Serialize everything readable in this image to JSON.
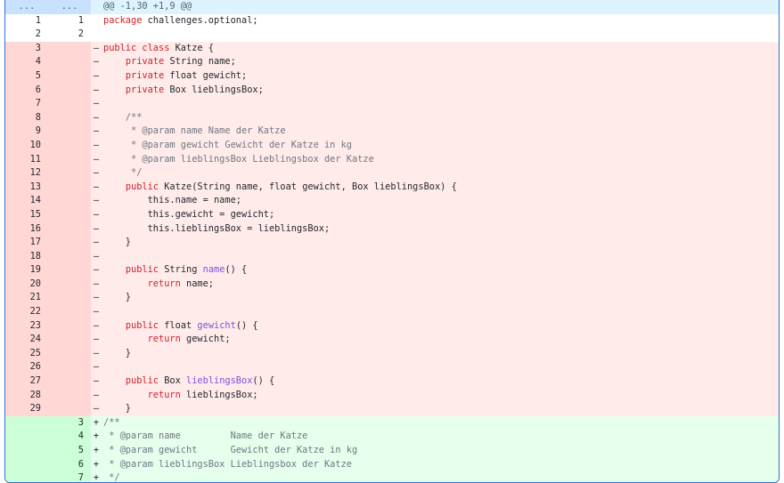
{
  "diff": {
    "hunk_header": "@@ -1,30 +1,9 @@",
    "expand_left": "...",
    "expand_right": "...",
    "lines": [
      {
        "type": "ctx",
        "old": "1",
        "new": "1",
        "sign": "",
        "tokens": [
          {
            "t": "kw",
            "v": "package"
          },
          {
            "t": "",
            "v": " challenges.optional;"
          }
        ]
      },
      {
        "type": "ctx",
        "old": "2",
        "new": "2",
        "sign": "",
        "tokens": []
      },
      {
        "type": "del",
        "old": "3",
        "new": "",
        "sign": "–",
        "tokens": [
          {
            "t": "kw",
            "v": "public class"
          },
          {
            "t": "",
            "v": " Katze {"
          }
        ]
      },
      {
        "type": "del",
        "old": "4",
        "new": "",
        "sign": "–",
        "tokens": [
          {
            "t": "",
            "v": "    "
          },
          {
            "t": "kw",
            "v": "private"
          },
          {
            "t": "",
            "v": " String name;"
          }
        ]
      },
      {
        "type": "del",
        "old": "5",
        "new": "",
        "sign": "–",
        "tokens": [
          {
            "t": "",
            "v": "    "
          },
          {
            "t": "kw",
            "v": "private"
          },
          {
            "t": "",
            "v": " float gewicht;"
          }
        ]
      },
      {
        "type": "del",
        "old": "6",
        "new": "",
        "sign": "–",
        "tokens": [
          {
            "t": "",
            "v": "    "
          },
          {
            "t": "kw",
            "v": "private"
          },
          {
            "t": "",
            "v": " Box lieblingsBox;"
          }
        ]
      },
      {
        "type": "del",
        "old": "7",
        "new": "",
        "sign": "–",
        "tokens": []
      },
      {
        "type": "del",
        "old": "8",
        "new": "",
        "sign": "–",
        "tokens": [
          {
            "t": "cm",
            "v": "    /**"
          }
        ]
      },
      {
        "type": "del",
        "old": "9",
        "new": "",
        "sign": "–",
        "tokens": [
          {
            "t": "cm",
            "v": "     * @param name Name der Katze"
          }
        ]
      },
      {
        "type": "del",
        "old": "10",
        "new": "",
        "sign": "–",
        "tokens": [
          {
            "t": "cm",
            "v": "     * @param gewicht Gewicht der Katze in kg"
          }
        ]
      },
      {
        "type": "del",
        "old": "11",
        "new": "",
        "sign": "–",
        "tokens": [
          {
            "t": "cm",
            "v": "     * @param lieblingsBox Lieblingsbox der Katze"
          }
        ]
      },
      {
        "type": "del",
        "old": "12",
        "new": "",
        "sign": "–",
        "tokens": [
          {
            "t": "cm",
            "v": "     */"
          }
        ]
      },
      {
        "type": "del",
        "old": "13",
        "new": "",
        "sign": "–",
        "tokens": [
          {
            "t": "",
            "v": "    "
          },
          {
            "t": "kw",
            "v": "public"
          },
          {
            "t": "",
            "v": " Katze(String name, float gewicht, Box lieblingsBox) {"
          }
        ]
      },
      {
        "type": "del",
        "old": "14",
        "new": "",
        "sign": "–",
        "tokens": [
          {
            "t": "",
            "v": "        this.name = name;"
          }
        ]
      },
      {
        "type": "del",
        "old": "15",
        "new": "",
        "sign": "–",
        "tokens": [
          {
            "t": "",
            "v": "        this.gewicht = gewicht;"
          }
        ]
      },
      {
        "type": "del",
        "old": "16",
        "new": "",
        "sign": "–",
        "tokens": [
          {
            "t": "",
            "v": "        this.lieblingsBox = lieblingsBox;"
          }
        ]
      },
      {
        "type": "del",
        "old": "17",
        "new": "",
        "sign": "–",
        "tokens": [
          {
            "t": "",
            "v": "    }"
          }
        ]
      },
      {
        "type": "del",
        "old": "18",
        "new": "",
        "sign": "–",
        "tokens": []
      },
      {
        "type": "del",
        "old": "19",
        "new": "",
        "sign": "–",
        "tokens": [
          {
            "t": "",
            "v": "    "
          },
          {
            "t": "kw",
            "v": "public"
          },
          {
            "t": "",
            "v": " String "
          },
          {
            "t": "fn",
            "v": "name"
          },
          {
            "t": "",
            "v": "() {"
          }
        ]
      },
      {
        "type": "del",
        "old": "20",
        "new": "",
        "sign": "–",
        "tokens": [
          {
            "t": "",
            "v": "        "
          },
          {
            "t": "kw",
            "v": "return"
          },
          {
            "t": "",
            "v": " name;"
          }
        ]
      },
      {
        "type": "del",
        "old": "21",
        "new": "",
        "sign": "–",
        "tokens": [
          {
            "t": "",
            "v": "    }"
          }
        ]
      },
      {
        "type": "del",
        "old": "22",
        "new": "",
        "sign": "–",
        "tokens": []
      },
      {
        "type": "del",
        "old": "23",
        "new": "",
        "sign": "–",
        "tokens": [
          {
            "t": "",
            "v": "    "
          },
          {
            "t": "kw",
            "v": "public"
          },
          {
            "t": "",
            "v": " float "
          },
          {
            "t": "fn",
            "v": "gewicht"
          },
          {
            "t": "",
            "v": "() {"
          }
        ]
      },
      {
        "type": "del",
        "old": "24",
        "new": "",
        "sign": "–",
        "tokens": [
          {
            "t": "",
            "v": "        "
          },
          {
            "t": "kw",
            "v": "return"
          },
          {
            "t": "",
            "v": " gewicht;"
          }
        ]
      },
      {
        "type": "del",
        "old": "25",
        "new": "",
        "sign": "–",
        "tokens": [
          {
            "t": "",
            "v": "    }"
          }
        ]
      },
      {
        "type": "del",
        "old": "26",
        "new": "",
        "sign": "–",
        "tokens": []
      },
      {
        "type": "del",
        "old": "27",
        "new": "",
        "sign": "–",
        "tokens": [
          {
            "t": "",
            "v": "    "
          },
          {
            "t": "kw",
            "v": "public"
          },
          {
            "t": "",
            "v": " Box "
          },
          {
            "t": "fn",
            "v": "lieblingsBox"
          },
          {
            "t": "",
            "v": "() {"
          }
        ]
      },
      {
        "type": "del",
        "old": "28",
        "new": "",
        "sign": "–",
        "tokens": [
          {
            "t": "",
            "v": "        "
          },
          {
            "t": "kw",
            "v": "return"
          },
          {
            "t": "",
            "v": " lieblingsBox;"
          }
        ]
      },
      {
        "type": "del",
        "old": "29",
        "new": "",
        "sign": "–",
        "tokens": [
          {
            "t": "",
            "v": "    }"
          }
        ]
      },
      {
        "type": "add",
        "old": "",
        "new": "3",
        "sign": "+",
        "tokens": [
          {
            "t": "cm",
            "v": "/**"
          }
        ]
      },
      {
        "type": "add",
        "old": "",
        "new": "4",
        "sign": "+",
        "tokens": [
          {
            "t": "cm",
            "v": " * @param name         Name der Katze"
          }
        ]
      },
      {
        "type": "add",
        "old": "",
        "new": "5",
        "sign": "+",
        "tokens": [
          {
            "t": "cm",
            "v": " * @param gewicht      Gewicht der Katze in kg"
          }
        ]
      },
      {
        "type": "add",
        "old": "",
        "new": "6",
        "sign": "+",
        "tokens": [
          {
            "t": "cm",
            "v": " * @param lieblingsBox Lieblingsbox der Katze"
          }
        ]
      },
      {
        "type": "add",
        "old": "",
        "new": "7",
        "sign": "+",
        "tokens": [
          {
            "t": "cm",
            "v": " */"
          }
        ]
      }
    ]
  }
}
